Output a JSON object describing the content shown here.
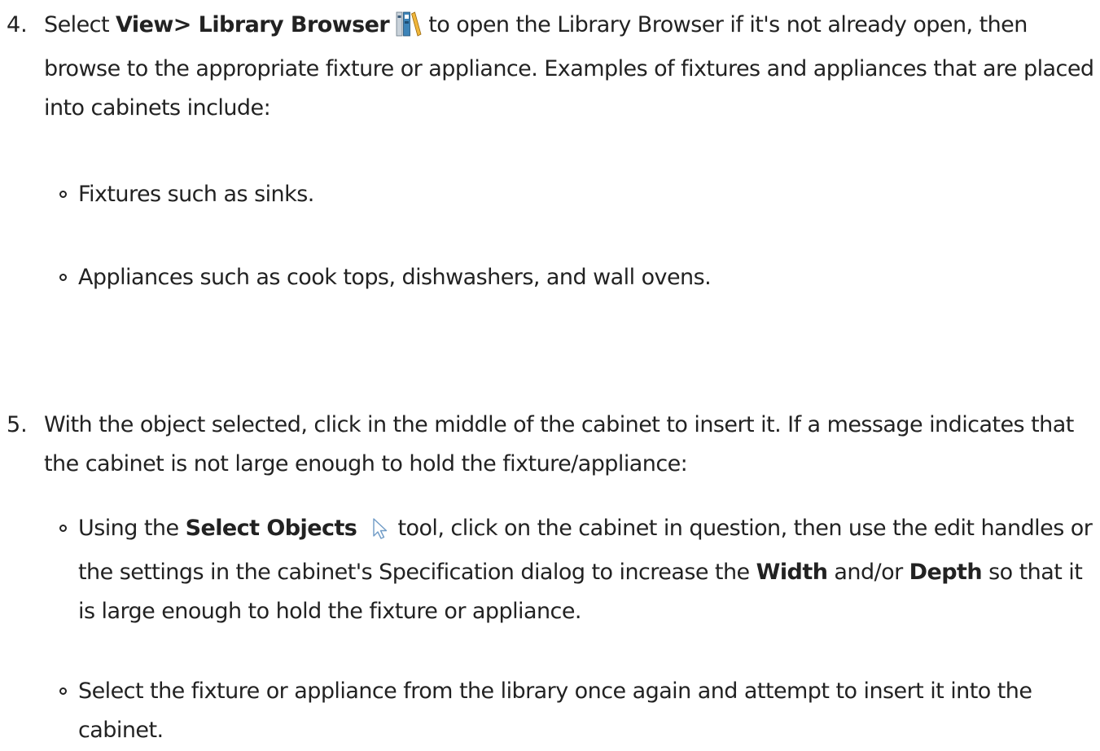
{
  "steps": [
    {
      "number": "4.",
      "pre": "Select ",
      "bold": "View> Library Browser",
      "post": " to open the Library Browser if it's not already open, then browse to the appropriate fixture or appliance. Examples of fixtures and appliances that are placed into cabinets include:",
      "icon": "library-browser-icon",
      "bullets": [
        "Fixtures such as sinks.",
        "Appliances such as cook tops, dishwashers, and wall ovens."
      ]
    },
    {
      "number": "5.",
      "text": "With the object selected, click in the middle of the cabinet to insert it. If a message indicates that the cabinet is not large enough to hold the fixture/appliance:",
      "bullet1": {
        "t1": "Using the ",
        "b1": "Select Objects",
        "icon": "select-objects-arrow-icon",
        "t2": " tool, click on the cabinet in question, then use the edit handles or the settings in the cabinet's Specification dialog to increase the ",
        "b2": "Width",
        "t3": " and/or ",
        "b3": "Depth",
        "t4": " so that it is large enough to hold the fixture or appliance."
      },
      "bullet2": "Select the fixture or appliance from the library once again and attempt to insert it into the cabinet."
    }
  ]
}
